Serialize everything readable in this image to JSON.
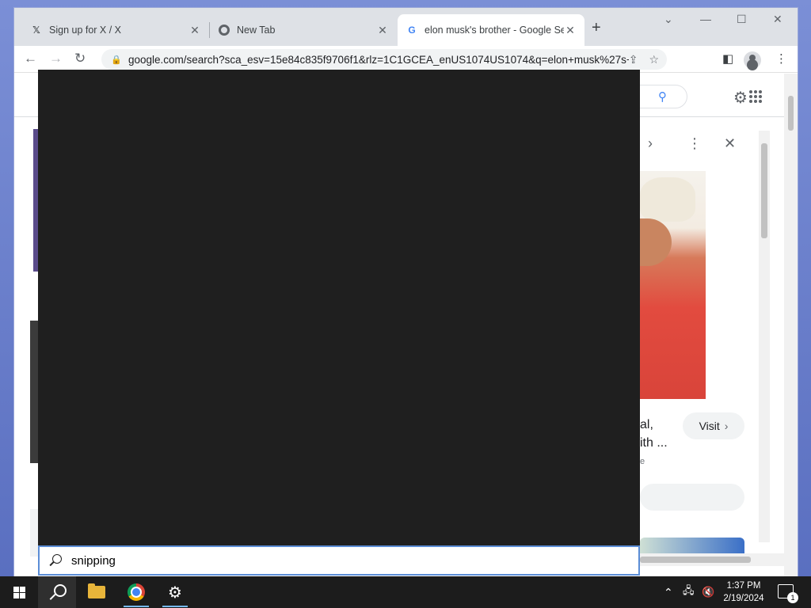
{
  "browser": {
    "tabs": [
      {
        "title": "Sign up for X / X",
        "icon": "x-logo-icon"
      },
      {
        "title": "New Tab",
        "icon": "chrome-icon"
      },
      {
        "title": "elon musk's brother - Google Se",
        "icon": "google-icon"
      }
    ],
    "url": "google.com/search?sca_esv=15e84c835f9706f1&rlz=1C1GCEA_enUS1074US1074&q=elon+musk%27s+br..."
  },
  "page": {
    "fragment_text_line1": "al,",
    "fragment_text_line2": "ith ...",
    "fragment_small": "e",
    "visit_label": "Visit"
  },
  "start_search": {
    "query": "snipping"
  },
  "taskbar": {
    "time": "1:37 PM",
    "date": "2/19/2024",
    "notification_count": "1"
  }
}
